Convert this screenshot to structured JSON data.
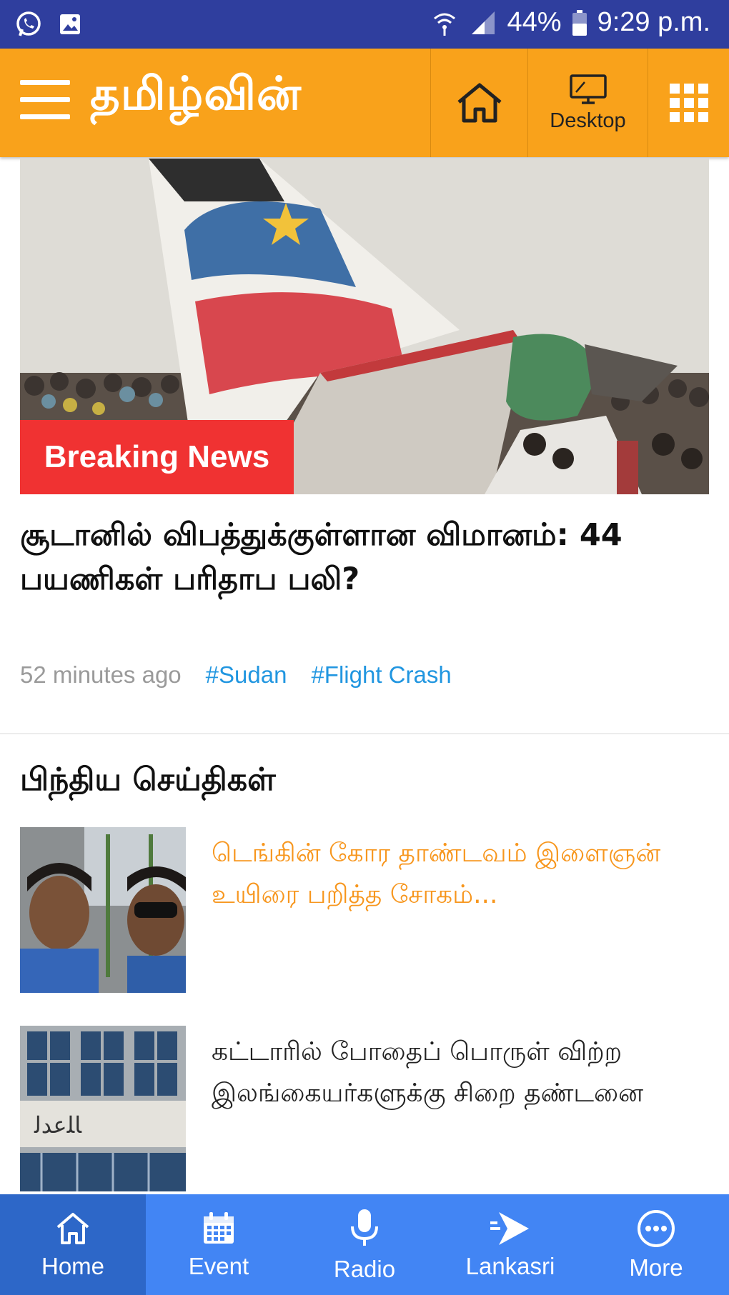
{
  "status_bar": {
    "left_icons": [
      "whatsapp-icon",
      "image-icon"
    ],
    "right_icons": [
      "wifi-icon",
      "cell-signal-icon",
      "battery-icon"
    ],
    "battery": "44%",
    "time": "9:29 p.m."
  },
  "app_bar": {
    "logo": "தமிழ்வின்",
    "home_icon": "home-icon",
    "desktop_label": "Desktop",
    "grid_icon": "apps-grid-icon"
  },
  "hero": {
    "badge": "Breaking News",
    "headline": "சூடானில் விபத்துக்குள்ளான விமானம்: 44 பயணிகள் பரிதாப பலி?",
    "time": "52 minutes ago",
    "tags": [
      "#Sudan",
      "#Flight Crash"
    ]
  },
  "section": {
    "title": "பிந்திய செய்திகள்"
  },
  "news_list": [
    {
      "title": "டெங்கின் கோர தாண்டவம் இளைஞன் உயிரை பறித்த சோகம்..."
    },
    {
      "title": "கட்டாரில் போதைப் பொருள் விற்ற இலங்கையர்களுக்கு சிறை தண்டனை"
    }
  ],
  "bottom_nav": [
    {
      "label": "Home",
      "icon": "home-icon",
      "active": true
    },
    {
      "label": "Event",
      "icon": "calendar-icon",
      "active": false
    },
    {
      "label": "Radio",
      "icon": "microphone-icon",
      "active": false
    },
    {
      "label": "Lankasri",
      "icon": "lankasri-logo-icon",
      "active": false
    },
    {
      "label": "More",
      "icon": "more-icon",
      "active": false
    }
  ],
  "colors": {
    "status_bar": "#2f3e9e",
    "app_bar": "#f9a21b",
    "breaking_badge": "#f03232",
    "tag": "#2196e0",
    "highlight_title": "#f7961d",
    "bottom_nav": "#4285f4",
    "bottom_nav_active": "#2d67c8"
  }
}
